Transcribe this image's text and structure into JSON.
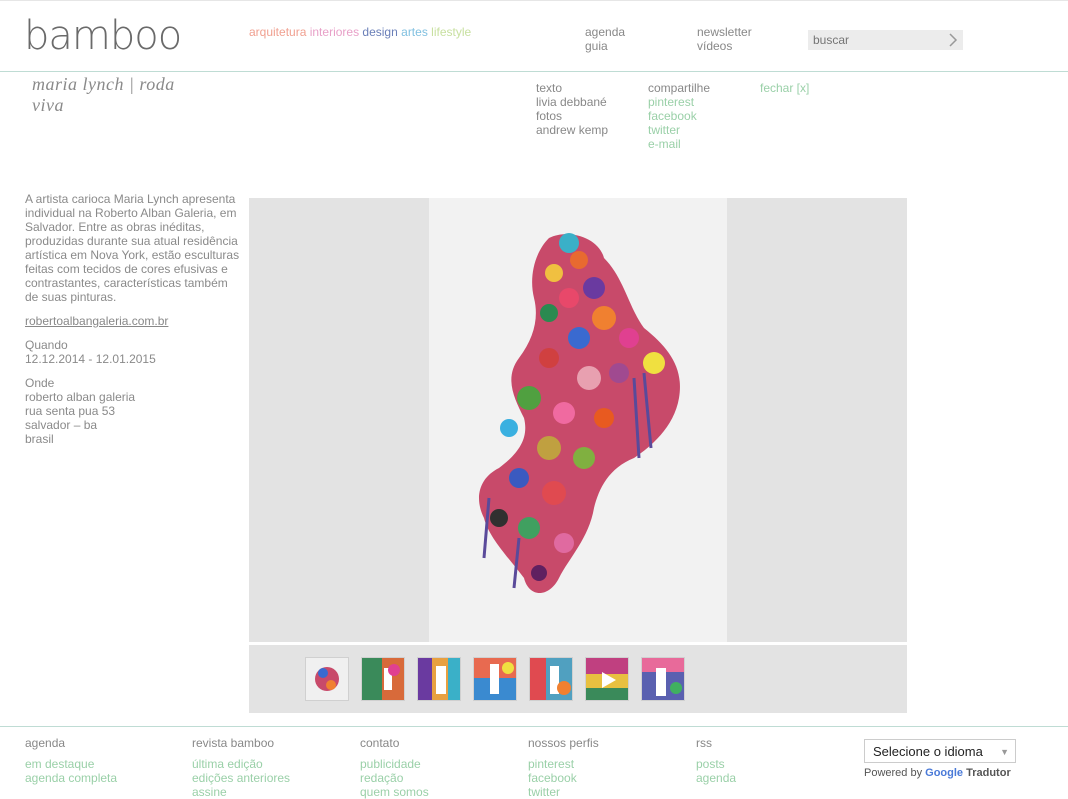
{
  "header": {
    "logo": "bamboo",
    "categories": [
      {
        "label": "arquitetura",
        "color": "#f0a090"
      },
      {
        "label": "interiores",
        "color": "#e8a0c8"
      },
      {
        "label": "design",
        "color": "#6a7fb8"
      },
      {
        "label": "artes",
        "color": "#80c0e0"
      },
      {
        "label": "lifestyle",
        "color": "#c8e0a0"
      }
    ],
    "nav": {
      "agenda": "agenda",
      "guia": "guia",
      "newsletter": "newsletter",
      "videos": "vídeos"
    },
    "search": {
      "placeholder": "buscar",
      "icon": "chevron-right-icon"
    }
  },
  "article": {
    "title": "maria lynch | roda viva",
    "credits": {
      "texto_label": "texto",
      "texto_author": "livia debbané",
      "fotos_label": "fotos",
      "fotos_author": "andrew kemp"
    },
    "share": {
      "label": "compartilhe",
      "links": [
        "pinterest",
        "facebook",
        "twitter",
        "e-mail"
      ]
    },
    "close": "fechar [x]",
    "description": "A artista carioca Maria Lynch apresenta individual na Roberto Alban Galeria, em Salvador. Entre as obras inéditas, produzidas durante sua atual residência artística em Nova York, estão esculturas feitas com tecidos de cores efusivas e contrastantes, características também de suas pinturas.",
    "link": "robertoalbangaleria.com.br",
    "when_label": "Quando",
    "when_value": "12.12.2014 - 12.01.2015",
    "where_label": "Onde",
    "where_lines": [
      "roberto alban galeria",
      "rua senta pua 53",
      "salvador – ba",
      "brasil"
    ]
  },
  "gallery": {
    "thumbnail_count": 7,
    "selected_thumbnail": 1
  },
  "footer": {
    "columns": [
      {
        "heading": "agenda",
        "links": [
          "em destaque",
          "agenda completa"
        ]
      },
      {
        "heading": "revista bamboo",
        "links": [
          "última edição",
          "edições anteriores",
          "assine"
        ]
      },
      {
        "heading": "contato",
        "links": [
          "publicidade",
          "redação",
          "quem somos"
        ]
      },
      {
        "heading": "nossos perfis",
        "links": [
          "pinterest",
          "facebook",
          "twitter"
        ]
      },
      {
        "heading": "rss",
        "links": [
          "posts",
          "agenda"
        ]
      }
    ],
    "language_select": "Selecione o idioma",
    "powered_by": "Powered by",
    "google": "Google",
    "translator": "Tradutor"
  }
}
